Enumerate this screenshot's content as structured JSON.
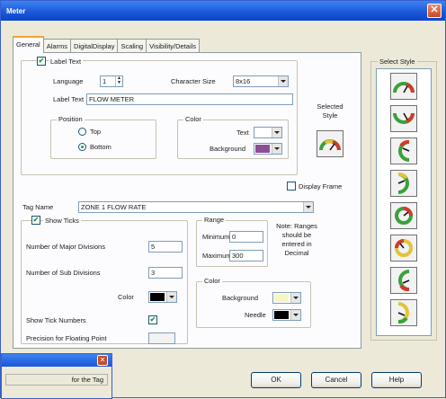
{
  "window": {
    "title": "Meter"
  },
  "tabs": [
    "General",
    "Alarms",
    "DigitalDisplay",
    "Scaling",
    "Visibility/Details"
  ],
  "label_text_section": {
    "checkbox_label": "Label Text",
    "language_label": "Language",
    "language_value": "1",
    "char_size_label": "Character Size",
    "char_size_value": "8x16",
    "label_text_label": "Label Text",
    "label_text_value": "FLOW METER",
    "position_title": "Position",
    "pos_top": "Top",
    "pos_bottom": "Bottom",
    "color_title": "Color",
    "text_label": "Text",
    "background_label": "Background",
    "text_color": "#ffffff",
    "background_color": "#8a4f96"
  },
  "selected_style_label": "Selected Style",
  "display_frame_label": "Display Frame",
  "tag_name": {
    "label": "Tag Name",
    "value": "ZONE 1 FLOW RATE"
  },
  "ticks": {
    "show_ticks_label": "Show Ticks",
    "major_label": "Number of Major Divisions",
    "major_value": "5",
    "sub_label": "Number of Sub Divisions",
    "sub_value": "3",
    "color_label": "Color",
    "color_value": "#000000",
    "show_tick_numbers_label": "Show Tick Numbers",
    "precision_label": "Precision for Floating Point",
    "precision_value": ""
  },
  "range": {
    "title": "Range",
    "minimum_label": "Minimum",
    "minimum_value": "0",
    "maximum_label": "Maximum",
    "maximum_value": "300"
  },
  "note": "Note: Ranges should be entered in Decimal",
  "color_group": {
    "title": "Color",
    "background_label": "Background",
    "background_color": "#f6f6c4",
    "needle_label": "Needle",
    "needle_color": "#000000"
  },
  "select_style_title": "Select Style",
  "buttons": {
    "ok": "OK",
    "cancel": "Cancel",
    "help": "Help"
  },
  "popup": {
    "text": "for the Tag"
  }
}
